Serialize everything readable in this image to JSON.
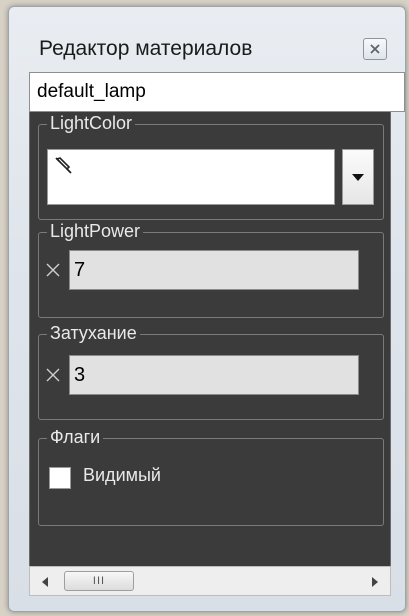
{
  "window": {
    "title": "Редактор материалов"
  },
  "material": {
    "name": "default_lamp"
  },
  "groups": {
    "light_color": {
      "label": "LightColor",
      "value_color": "#ffffff"
    },
    "light_power": {
      "label": "LightPower",
      "value": "7"
    },
    "attenuation": {
      "label": "Затухание",
      "value": "3"
    },
    "flags": {
      "label": "Флаги",
      "visible_label": "Видимый",
      "visible_checked": false
    }
  },
  "scrollbar": {
    "thumb_grip": "III"
  },
  "icons": [
    "close-icon",
    "eyedropper-icon",
    "dropdown-arrow-icon",
    "x-axis-icon",
    "scroll-left-icon",
    "scroll-right-icon"
  ]
}
